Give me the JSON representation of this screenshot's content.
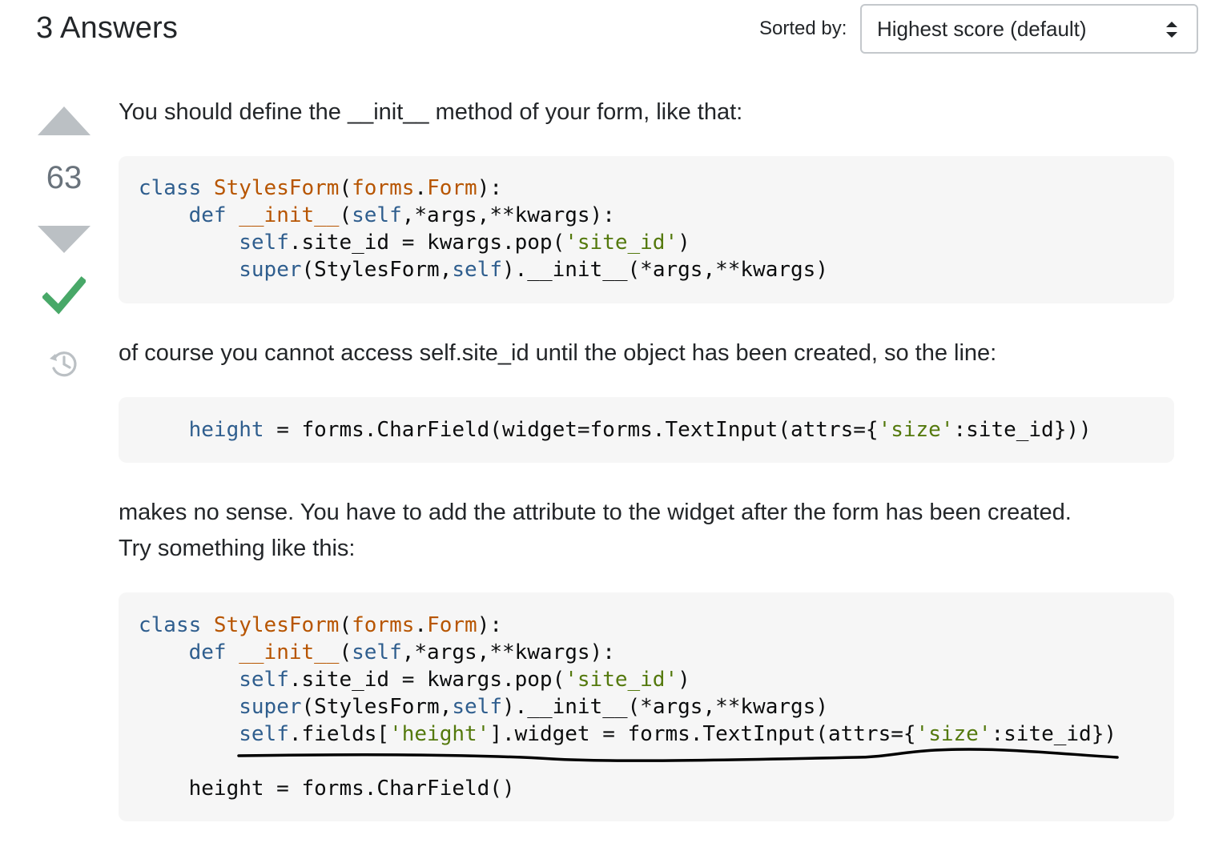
{
  "header": {
    "answers_count_label": "3 Answers",
    "sort_label": "Sorted by:",
    "sort_selected": "Highest score (default)"
  },
  "vote": {
    "score": "63"
  },
  "answer": {
    "para1": "You should define the __init__ method of your form, like that:",
    "para2": "of course you cannot access self.site_id until the object has been created, so the line:",
    "para3_line1": "makes no sense. You have to add the attribute to the widget after the form has been created.",
    "para3_line2": "Try something like this:",
    "code1": {
      "l1a": "class ",
      "l1b": "StylesForm",
      "l1c": "(",
      "l1d": "forms",
      "l1e": ".",
      "l1f": "Form",
      "l1g": "):",
      "l2a": "    def ",
      "l2b": "__init__",
      "l2c": "(",
      "l2d": "self",
      "l2e": ",*args,**kwargs):",
      "l3a": "        ",
      "l3b": "self",
      "l3c": ".site_id = kwargs.pop(",
      "l3d": "'site_id'",
      "l3e": ")",
      "l4a": "        ",
      "l4b": "super",
      "l4c": "(StylesForm,",
      "l4d": "self",
      "l4e": ").__init__(*args,**kwargs)"
    },
    "code2": {
      "l1a": "    ",
      "l1b": "height",
      "l1c": " = forms.CharField(widget=forms.TextInput(attrs={",
      "l1d": "'size'",
      "l1e": ":site_id}))"
    },
    "code3": {
      "l1a": "class ",
      "l1b": "StylesForm",
      "l1c": "(",
      "l1d": "forms",
      "l1e": ".",
      "l1f": "Form",
      "l1g": "):",
      "l2a": "    def ",
      "l2b": "__init__",
      "l2c": "(",
      "l2d": "self",
      "l2e": ",*args,**kwargs):",
      "l3a": "        ",
      "l3b": "self",
      "l3c": ".site_id = kwargs.pop(",
      "l3d": "'site_id'",
      "l3e": ")",
      "l4a": "        ",
      "l4b": "super",
      "l4c": "(StylesForm,",
      "l4d": "self",
      "l4e": ").__init__(*args,**kwargs)",
      "l5a": "        ",
      "l5b": "self",
      "l5c": ".fields[",
      "l5d": "'height'",
      "l5e": "].widget = forms.TextInput(attrs={",
      "l5f": "'size'",
      "l5g": ":site_id})",
      "l7": "    height = forms.CharField()"
    }
  },
  "icons": {
    "vote_up": "arrow-up-icon",
    "vote_down": "arrow-down-icon",
    "accepted": "checkmark-icon",
    "history": "history-icon",
    "sort": "sort-arrows-icon"
  },
  "colors": {
    "accepted": "#48a868",
    "vote_arrow": "#bbc0c4",
    "keyword": "#2f5e8e",
    "class_name": "#b75501",
    "string": "#54790d",
    "code_bg": "#f6f6f6"
  }
}
